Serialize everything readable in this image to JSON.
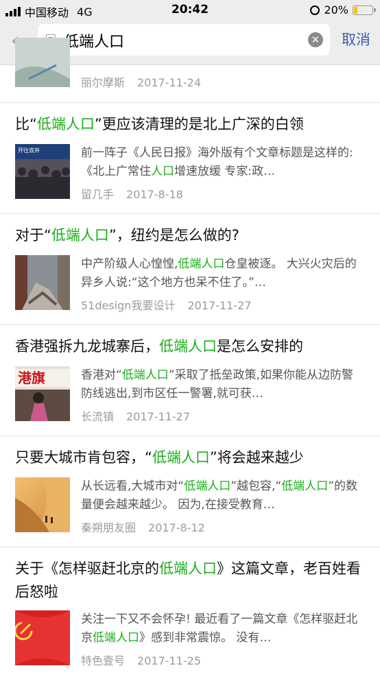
{
  "status": {
    "carrier": "中国移动",
    "network": "4G",
    "time": "20:42",
    "battery": "20%",
    "battery_fraction": 0.2
  },
  "search": {
    "query": "低端人口",
    "cancel_label": "取消"
  },
  "results": [
    {
      "partial": true,
      "snippet_parts": [
        "…"
      ],
      "source": "丽尔摩斯",
      "date": "2017-11-24"
    },
    {
      "title_parts": [
        "比“",
        "低端人口",
        "”更应该清理的是北上广深的白领"
      ],
      "snippet_parts": [
        "前一阵子《人民日报》海外版有个文章标题是这样的:《北上广常住",
        "人口",
        "增速放缓 专家:政…"
      ],
      "source": "留几手",
      "date": "2017-8-18",
      "thumb_text": "开往双井"
    },
    {
      "title_parts": [
        "对于“",
        "低端人口",
        "”，纽约是怎么做的?"
      ],
      "snippet_parts": [
        "中产阶级人心惶惶,",
        "低端人口",
        "仓皇被逐。 大兴火灾后的异乡人说:“这个地方也呆不住了。”…"
      ],
      "source": "51design我要设计",
      "date": "2017-11-27"
    },
    {
      "title_parts": [
        "香港强拆九龙城寨后，",
        "低端人口",
        "是怎么安排的"
      ],
      "snippet_parts": [
        "香港对“",
        "低端人口",
        "”采取了抵垒政策,如果你能从边防警防线逃出,到市区任一警署,就可获…"
      ],
      "source": "长流镇",
      "date": "2017-11-27",
      "thumb_text": "港旗"
    },
    {
      "title_parts": [
        "只要大城市肯包容，“",
        "低端人口",
        "”将会越来越少"
      ],
      "snippet_parts": [
        "从长远看,大城市对“",
        "低端人口",
        "”越包容,“",
        "低端人口",
        "”的数量便会越来越少。 因为,在接受教育…"
      ],
      "source": "秦朔朋友圈",
      "date": "2017-8-12"
    },
    {
      "title_parts": [
        "关于《怎样驱赶北京的",
        "低端人口",
        "》这篇文章，老百姓看后怒啦"
      ],
      "snippet_parts": [
        "关注一下又不会怀孕! 最近看了一篇文章《怎样驱赶北京",
        "低端人口",
        "》感到非常震惊。 没有…"
      ],
      "source": "特色壹号",
      "date": "2017-11-25"
    }
  ],
  "colors": {
    "highlight": "#1aad19",
    "accent": "#3b5ea8",
    "header_bg": "#ededed"
  }
}
